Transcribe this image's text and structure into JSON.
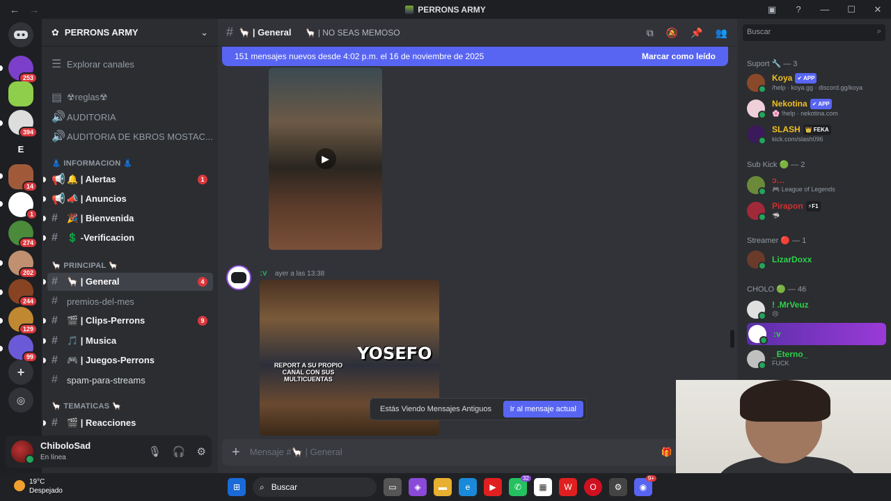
{
  "window": {
    "title": "PERRONS ARMY",
    "back": "←",
    "forward": "→"
  },
  "rail": {
    "servers": [
      {
        "badge": "253",
        "color": "#7b3fc9"
      },
      {
        "badge": "",
        "color": "#6aa84f"
      },
      {
        "badge": "394",
        "color": "#dddddd"
      },
      {
        "badge": "",
        "label": "E",
        "color": "#1e1f22"
      },
      {
        "badge": "14",
        "color": "#a05a3a"
      },
      {
        "badge": "1",
        "color": "#ffffff"
      },
      {
        "badge": "274",
        "color": "#4a8a3a"
      },
      {
        "badge": "202",
        "color": "#c09070"
      },
      {
        "badge": "244",
        "color": "#884422"
      },
      {
        "badge": "129",
        "color": "#c08830"
      },
      {
        "badge": "99",
        "color": "#6a5ad8"
      }
    ]
  },
  "guild": {
    "name": "PERRONS ARMY"
  },
  "channels": {
    "explore": "Explorar canales",
    "rules": "☢reglas☢",
    "audit": "AUDITORIA",
    "audit2": "AUDITORIA DE KBROS MOSTAC...",
    "cat_info": "👗 INFORMACION 👗",
    "alertas": "🔔 | Alertas",
    "alertas_badge": "1",
    "anuncios": "📣 | Anuncios",
    "bienvenida": "🎉 | Bienvenida",
    "verificacion": "💲 -Verificacion",
    "cat_principal": "🦙 PRINCIPAL 🦙",
    "general": "🦙 | General",
    "general_badge": "4",
    "premios": "premios-del-mes",
    "clips": "🎬 | Clips-Perrons",
    "clips_badge": "9",
    "musica": "🎵 | Musica",
    "juegos": "🎮 | Juegos-Perrons",
    "spam": "spam-para-streams",
    "cat_tematicas": "🦙 TEMATICAS 🦙",
    "reacciones": "🎬 | Reacciones"
  },
  "user": {
    "name": "ChiboloSad",
    "status": "En línea"
  },
  "chat": {
    "channel": "🦙 | General",
    "topic": "🦙 | NO SEAS MEMOSO",
    "banner": "151 mensajes nuevos desde 4:02 p.m. el 16 de noviembre de 2025",
    "mark_read": "Marcar como leído",
    "author": ":v",
    "timestamp": "ayer a las 13:38",
    "meme_big": "YOSEFO",
    "meme_small": "REPORT A SU PROPIO CANAL CON SUS MULTICUENTAS",
    "toast": "Estás Viendo Mensajes Antiguos",
    "toast_btn": "Ir al mensaje actual",
    "composer_placeholder": "Mensaje #🦙 | General"
  },
  "members": {
    "search": "Buscar",
    "groups": [
      {
        "title": "Suport 🔧 — 3"
      },
      {
        "title": "Sub Kick 🟢 — 2"
      },
      {
        "title": "Streamer 🔴 — 1"
      },
      {
        "title": "CHOLO 🟢 — 46"
      }
    ],
    "list": [
      {
        "name": "Koya",
        "tag": "✔ APP",
        "sub": "/help · koya.gg · discord.gg/koya",
        "color": "#f0c020"
      },
      {
        "name": "Nekotina",
        "tag": "✔ APP",
        "sub": "🌸 !help · nekotina.com",
        "color": "#f0c020"
      },
      {
        "name": "SLASH",
        "tag": "👑 FEKA",
        "sub": "kick.com/slash096",
        "color": "#f0c020"
      },
      {
        "name": "ↄ…",
        "tag": "",
        "sub": "🎮 League of Legends",
        "color": "#d03030"
      },
      {
        "name": "Pirapon",
        "tag": "⚡F1",
        "sub": "🦈",
        "color": "#d03030"
      },
      {
        "name": "LizarDoxx",
        "tag": "",
        "sub": "",
        "color": "#2dd24a"
      },
      {
        "name": "! .MrVeuz",
        "tag": "",
        "sub": "😢",
        "color": "#2dd24a"
      },
      {
        "name": ":v",
        "tag": "",
        "sub": "",
        "color": "#2dd24a"
      },
      {
        "name": "_Eterno_",
        "tag": "",
        "sub": "FUCK",
        "color": "#2dd24a"
      }
    ]
  },
  "taskbar": {
    "temp": "19°C",
    "weather": "Despejado",
    "search": "Buscar",
    "whatsapp_badge": "32",
    "discord_badge": "9+"
  }
}
